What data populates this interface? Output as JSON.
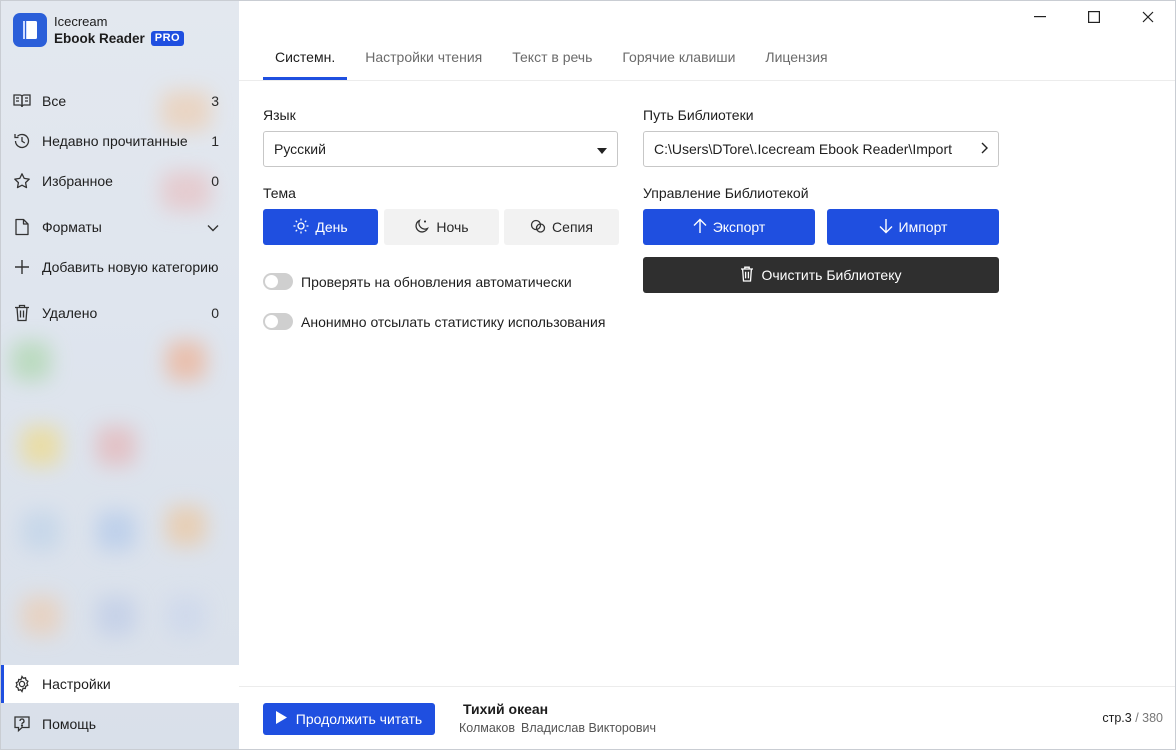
{
  "app": {
    "name_line1": "Icecream",
    "name_line2": "Ebook Reader",
    "badge": "PRO"
  },
  "sidebar": {
    "items": [
      {
        "label": "Все",
        "count": "3",
        "icon": "book-open-icon"
      },
      {
        "label": "Недавно прочитанные",
        "count": "1",
        "icon": "history-icon"
      },
      {
        "label": "Избранное",
        "count": "0",
        "icon": "star-icon"
      },
      {
        "label": "Форматы",
        "icon": "file-icon"
      },
      {
        "label": "Добавить новую категорию",
        "icon": "plus-icon"
      },
      {
        "label": "Удалено",
        "count": "0",
        "icon": "trash-icon"
      }
    ],
    "bottom": [
      {
        "label": "Настройки",
        "icon": "gear-icon",
        "active": true
      },
      {
        "label": "Помощь",
        "icon": "help-icon"
      }
    ]
  },
  "tabs": [
    {
      "label": "Системн.",
      "active": true
    },
    {
      "label": "Настройки чтения"
    },
    {
      "label": "Текст в речь"
    },
    {
      "label": "Горячие клавиши"
    },
    {
      "label": "Лицензия"
    }
  ],
  "settings": {
    "language_label": "Язык",
    "language_value": "Русский",
    "theme_label": "Тема",
    "themes": [
      {
        "label": "День",
        "icon": "sun-icon",
        "active": true
      },
      {
        "label": "Ночь",
        "icon": "moon-icon"
      },
      {
        "label": "Сепия",
        "icon": "sepia-icon"
      }
    ],
    "toggle_updates": "Проверять на обновления автоматически",
    "toggle_stats": "Анонимно отсылать статистику использования",
    "library_path_label": "Путь Библиотеки",
    "library_path_value": "C:\\Users\\DTore\\.Icecream Ebook Reader\\Import",
    "library_manage_label": "Управление Библиотекой",
    "export_label": "Экспорт",
    "import_label": "Импорт",
    "clear_label": "Очистить Библиотеку"
  },
  "bottom_bar": {
    "continue_label": "Продолжить читать",
    "book_title": "Тихий океан",
    "author_last": "Колмаков",
    "author_first": "Владислав Викторович",
    "page_prefix": "стр.3",
    "page_total": " / 380"
  },
  "colors": {
    "accent": "#1f4fe0",
    "dark_button": "#2f2f2f"
  }
}
